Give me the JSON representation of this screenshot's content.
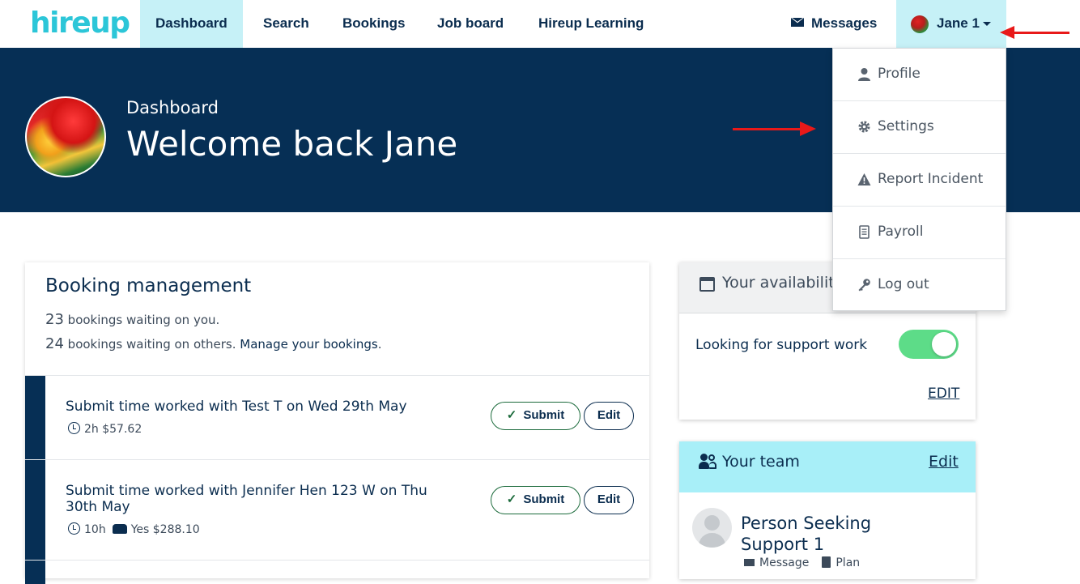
{
  "nav": {
    "logo": "hireup",
    "items": [
      {
        "label": "Dashboard",
        "active": true
      },
      {
        "label": "Search"
      },
      {
        "label": "Bookings"
      },
      {
        "label": "Job board"
      },
      {
        "label": "Hireup Learning"
      }
    ],
    "messages_label": "Messages",
    "user_name": "Jane 1"
  },
  "hero": {
    "subtitle": "Dashboard",
    "title": "Welcome back Jane"
  },
  "booking_management": {
    "title": "Booking management",
    "waiting_on_you_count": "23",
    "waiting_on_you_text": " bookings waiting on you.",
    "waiting_on_others_count": "24",
    "waiting_on_others_text": " bookings waiting on others. ",
    "manage_link": "Manage your bookings",
    "period": ".",
    "rows": [
      {
        "title": "Submit time worked with Test T on Wed 29th May",
        "hours": "2h",
        "amount": "$57.62",
        "travel": ""
      },
      {
        "title": "Submit time worked with Jennifer Hen 123 W on Thu 30th May",
        "hours": "10h",
        "amount": "$288.10",
        "travel": "Yes"
      }
    ],
    "submit_label": "Submit",
    "edit_label": "Edit"
  },
  "availability": {
    "title": "Your availabilit",
    "toggle_label": "Looking for support work",
    "toggle_on": true,
    "edit_label": "EDIT"
  },
  "team": {
    "title": "Your team",
    "edit_label": "Edit",
    "person_name": "Person Seeking Support 1",
    "message_label": "Message",
    "plan_label": "Plan"
  },
  "dropdown": {
    "items": [
      {
        "label": "Profile",
        "icon": "user-icon"
      },
      {
        "label": "Settings",
        "icon": "gear-icon"
      },
      {
        "label": "Report Incident",
        "icon": "warning-icon"
      },
      {
        "label": "Payroll",
        "icon": "document-icon"
      },
      {
        "label": "Log out",
        "icon": "key-icon"
      }
    ]
  },
  "colors": {
    "brand": "#2cc6d8",
    "navy": "#062f55",
    "active_tab": "#c6f1f7",
    "toggle_on": "#5ddc88",
    "annotation": "#e81919"
  }
}
